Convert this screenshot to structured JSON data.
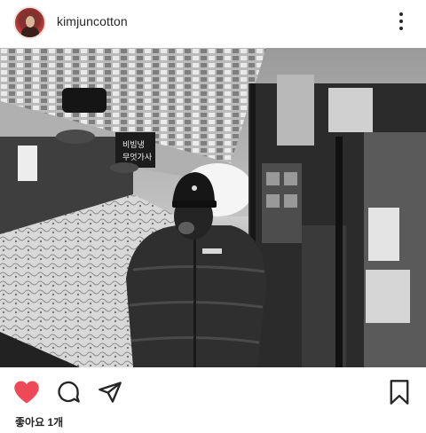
{
  "post": {
    "username": "kimjuncotton",
    "likes_text": "좋아요 1개"
  },
  "icons": {
    "more": "more-vertical-icon",
    "like": "heart-filled-icon",
    "comment": "comment-icon",
    "share": "send-icon",
    "save": "bookmark-icon"
  },
  "colors": {
    "like_active": "#ed4956",
    "text": "#262626"
  }
}
